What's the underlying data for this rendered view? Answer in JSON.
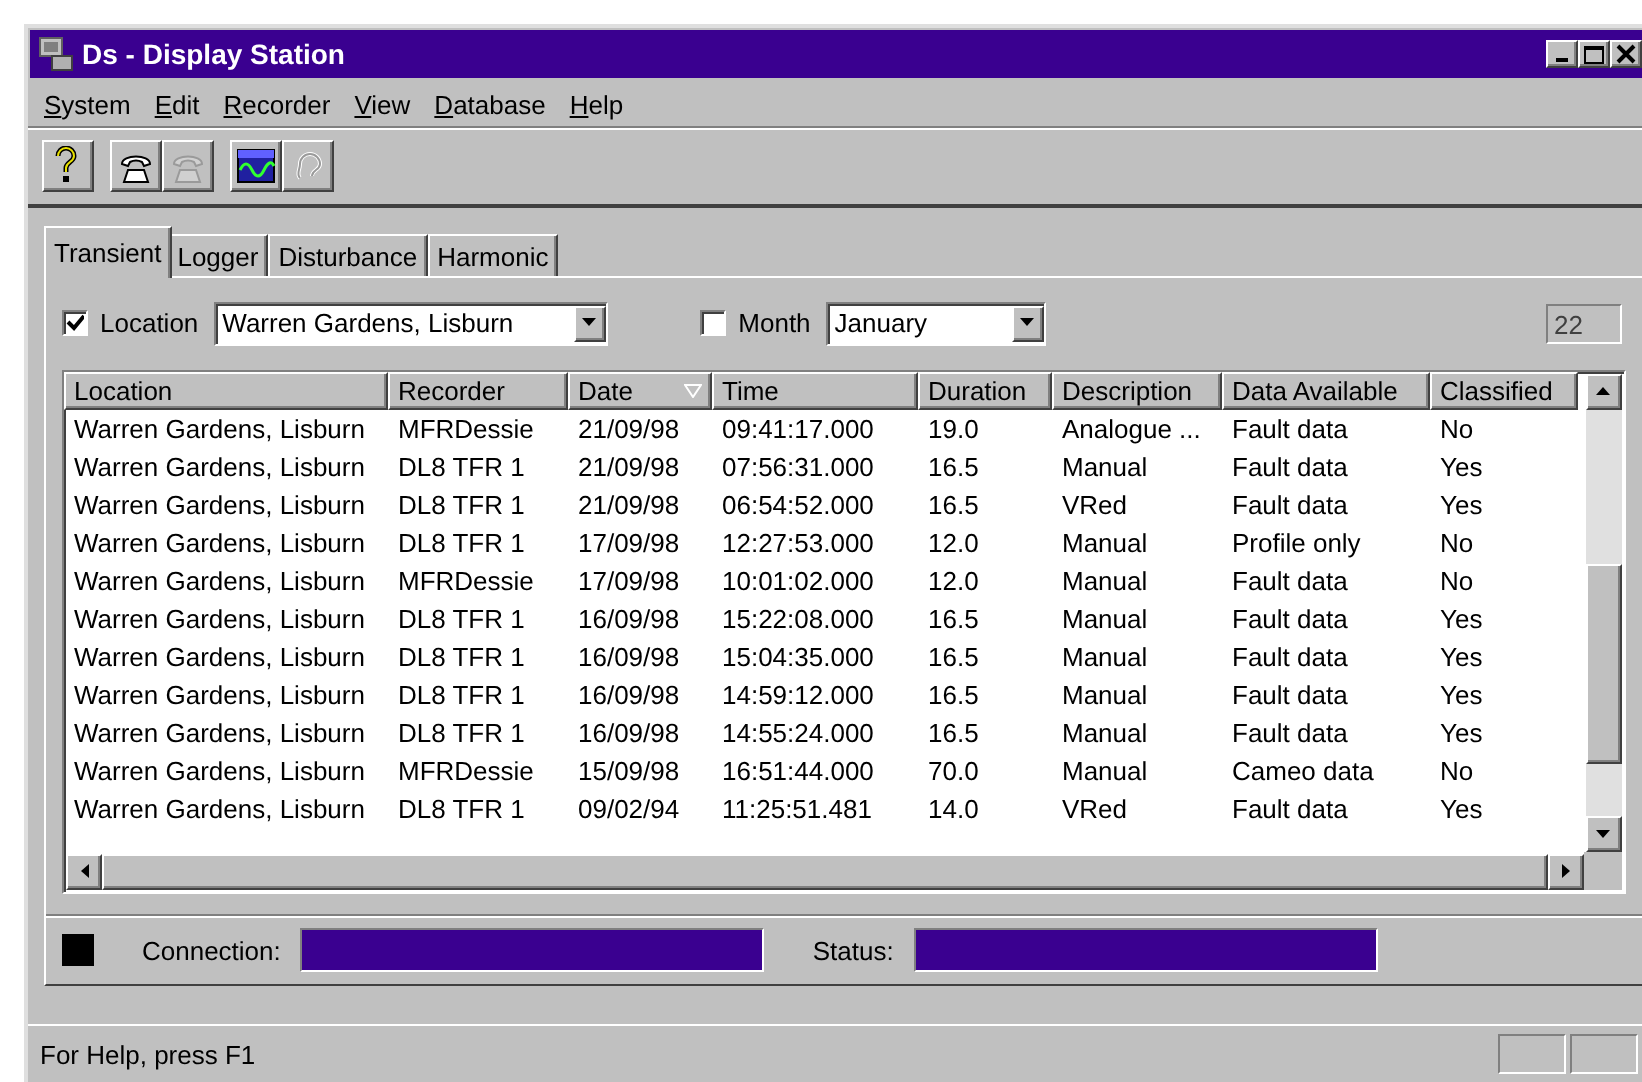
{
  "window": {
    "title": "Ds - Display Station"
  },
  "menu": [
    "System",
    "Edit",
    "Recorder",
    "View",
    "Database",
    "Help"
  ],
  "toolbar": [
    [
      {
        "kind": "help",
        "disabled": false
      }
    ],
    [
      {
        "kind": "phone",
        "disabled": false
      },
      {
        "kind": "phone",
        "disabled": true
      }
    ],
    [
      {
        "kind": "wave",
        "disabled": false
      },
      {
        "kind": "ear",
        "disabled": true
      }
    ]
  ],
  "tabs": [
    {
      "label": "Transient",
      "selected": true
    },
    {
      "label": "Logger",
      "selected": false
    },
    {
      "label": "Disturbance",
      "selected": false
    },
    {
      "label": "Harmonic",
      "selected": false
    }
  ],
  "filter": {
    "location": {
      "label": "Location",
      "checked": true,
      "value": "Warren Gardens, Lisburn"
    },
    "month": {
      "label": "Month",
      "checked": false,
      "value": "January"
    },
    "count": "22"
  },
  "table": {
    "columns": [
      {
        "label": "Location",
        "sorted": false
      },
      {
        "label": "Recorder",
        "sorted": false
      },
      {
        "label": "Date",
        "sorted": true
      },
      {
        "label": "Time",
        "sorted": false
      },
      {
        "label": "Duration",
        "sorted": false
      },
      {
        "label": "Description",
        "sorted": false
      },
      {
        "label": "Data Available",
        "sorted": false
      },
      {
        "label": "Classified",
        "sorted": false
      }
    ],
    "rows": [
      [
        "Warren Gardens, Lisburn",
        "MFRDessie",
        "21/09/98",
        "09:41:17.000",
        "19.0",
        "Analogue ...",
        "Fault data",
        "No"
      ],
      [
        "Warren Gardens, Lisburn",
        "DL8 TFR 1",
        "21/09/98",
        "07:56:31.000",
        "16.5",
        "Manual",
        "Fault data",
        "Yes"
      ],
      [
        "Warren Gardens, Lisburn",
        "DL8 TFR 1",
        "21/09/98",
        "06:54:52.000",
        "16.5",
        "VRed",
        "Fault data",
        "Yes"
      ],
      [
        "Warren Gardens, Lisburn",
        "DL8 TFR 1",
        "17/09/98",
        "12:27:53.000",
        "12.0",
        "Manual",
        "Profile only",
        "No"
      ],
      [
        "Warren Gardens, Lisburn",
        "MFRDessie",
        "17/09/98",
        "10:01:02.000",
        "12.0",
        "Manual",
        "Fault data",
        "No"
      ],
      [
        "Warren Gardens, Lisburn",
        "DL8 TFR 1",
        "16/09/98",
        "15:22:08.000",
        "16.5",
        "Manual",
        "Fault data",
        "Yes"
      ],
      [
        "Warren Gardens, Lisburn",
        "DL8 TFR 1",
        "16/09/98",
        "15:04:35.000",
        "16.5",
        "Manual",
        "Fault data",
        "Yes"
      ],
      [
        "Warren Gardens, Lisburn",
        "DL8 TFR 1",
        "16/09/98",
        "14:59:12.000",
        "16.5",
        "Manual",
        "Fault data",
        "Yes"
      ],
      [
        "Warren Gardens, Lisburn",
        "DL8 TFR 1",
        "16/09/98",
        "14:55:24.000",
        "16.5",
        "Manual",
        "Fault data",
        "Yes"
      ],
      [
        "Warren Gardens, Lisburn",
        "MFRDessie",
        "15/09/98",
        "16:51:44.000",
        "70.0",
        "Manual",
        "Cameo data",
        "No"
      ],
      [
        "Warren Gardens, Lisburn",
        "DL8 TFR 1",
        "09/02/94",
        "11:25:51.481",
        "14.0",
        "VRed",
        "Fault data",
        "Yes"
      ]
    ]
  },
  "connection_panel": {
    "connection_label": "Connection:",
    "status_label": "Status:"
  },
  "status_bar": {
    "text": "For Help, press F1"
  }
}
